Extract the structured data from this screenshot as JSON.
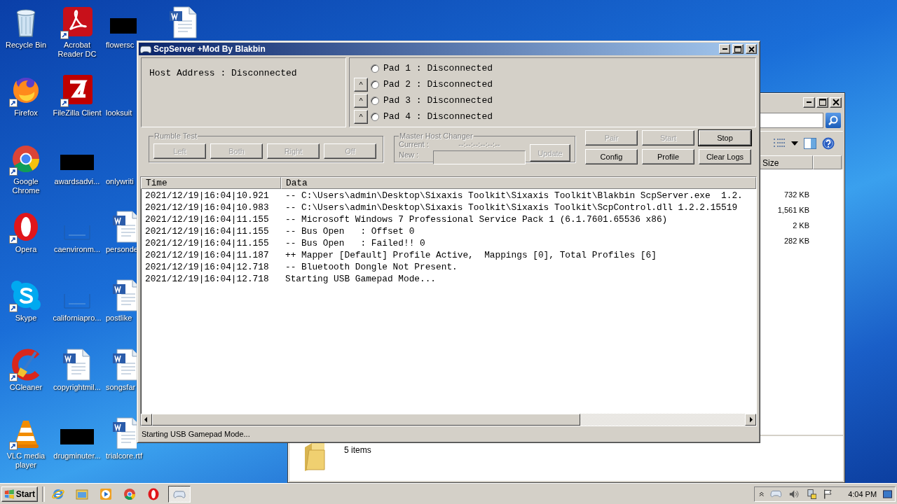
{
  "desktop": {
    "columns": [
      [
        {
          "label": "Recycle Bin",
          "kind": "recycle",
          "shortcut": false
        },
        {
          "label": "Firefox",
          "kind": "firefox",
          "shortcut": true
        },
        {
          "label": "Google Chrome",
          "kind": "chrome",
          "shortcut": true
        },
        {
          "label": "Opera",
          "kind": "opera",
          "shortcut": true
        },
        {
          "label": "Skype",
          "kind": "skype",
          "shortcut": true
        },
        {
          "label": "CCleaner",
          "kind": "ccleaner",
          "shortcut": true
        },
        {
          "label": "VLC media player",
          "kind": "vlc",
          "shortcut": true
        }
      ],
      [
        {
          "label": "Acrobat Reader DC",
          "kind": "acrobat",
          "shortcut": true
        },
        {
          "label": "FileZilla Client",
          "kind": "filezilla",
          "shortcut": true
        },
        {
          "label": "awardsadvi...",
          "kind": "redacted",
          "shortcut": false
        },
        {
          "label": "caenvironm...",
          "kind": "faint",
          "shortcut": false
        },
        {
          "label": "californiapro...",
          "kind": "faint",
          "shortcut": false
        },
        {
          "label": "copyrightmil...",
          "kind": "word",
          "shortcut": false
        },
        {
          "label": "drugminuter...",
          "kind": "redacted",
          "shortcut": false
        }
      ],
      [
        {
          "label": "flowersc",
          "kind": "redacted",
          "shortcut": false
        },
        {
          "label": "looksuit",
          "kind": "empty",
          "shortcut": false
        },
        {
          "label": "onlywriti",
          "kind": "empty",
          "shortcut": false
        },
        {
          "label": "personde",
          "kind": "word",
          "shortcut": false
        },
        {
          "label": "postlike",
          "kind": "word",
          "shortcut": false
        },
        {
          "label": "songsfar",
          "kind": "word",
          "shortcut": false
        },
        {
          "label": "trialcore.rtf",
          "kind": "word",
          "shortcut": false
        }
      ],
      [
        {
          "kind": "word",
          "shortcut": false
        }
      ]
    ]
  },
  "explorer_window": {
    "size_header": "Size",
    "sizes": [
      "732 KB",
      "1,561 KB",
      "2 KB",
      "282 KB"
    ],
    "details": "5 items"
  },
  "scp_window": {
    "title": "ScpServer +Mod By Blakbin",
    "host_address": "Host Address : Disconnected",
    "pads": [
      {
        "label": "Pad 1 : Disconnected",
        "selected": false
      },
      {
        "label": "Pad 2 : Disconnected",
        "selected": false,
        "button": "^"
      },
      {
        "label": "Pad 3 : Disconnected",
        "selected": false,
        "button": "^"
      },
      {
        "label": "Pad 4 : Disconnected",
        "selected": false,
        "button": "^"
      }
    ],
    "rumble": {
      "title": "Rumble Test",
      "buttons": [
        {
          "label": "Left",
          "disabled": true
        },
        {
          "label": "Both",
          "disabled": true
        },
        {
          "label": "Right",
          "disabled": true
        },
        {
          "label": "Off",
          "disabled": true
        }
      ]
    },
    "host_changer": {
      "title": "Master Host Changer",
      "current_label": "Current :",
      "current_value": "--:--:--:--:--:--",
      "new_label": "New :",
      "update": {
        "label": "Update",
        "disabled": true
      }
    },
    "actions": [
      {
        "label": "Pair",
        "disabled": true,
        "default": false
      },
      {
        "label": "Start",
        "disabled": true,
        "default": false
      },
      {
        "label": "Stop",
        "disabled": false,
        "default": true
      },
      {
        "label": "Config",
        "disabled": false,
        "default": false
      },
      {
        "label": "Profile",
        "disabled": false,
        "default": false
      },
      {
        "label": "Clear Logs",
        "disabled": false,
        "default": false
      }
    ],
    "log": {
      "columns": [
        "Time",
        "Data"
      ],
      "rows": [
        [
          "2021/12/19|16:04|10.921",
          "-- C:\\Users\\admin\\Desktop\\Sixaxis Toolkit\\Sixaxis Toolkit\\Blakbin ScpServer.exe  1.2."
        ],
        [
          "2021/12/19|16:04|10.983",
          "-- C:\\Users\\admin\\Desktop\\Sixaxis Toolkit\\Sixaxis Toolkit\\ScpControl.dll 1.2.2.15519"
        ],
        [
          "2021/12/19|16:04|11.155",
          "-- Microsoft Windows 7 Professional Service Pack 1 (6.1.7601.65536 x86)"
        ],
        [
          "2021/12/19|16:04|11.155",
          "-- Bus Open   : Offset 0"
        ],
        [
          "2021/12/19|16:04|11.155",
          "-- Bus Open   : Failed!! 0"
        ],
        [
          "2021/12/19|16:04|11.187",
          "++ Mapper [Default] Profile Active,  Mappings [0], Total Profiles [6]"
        ],
        [
          "2021/12/19|16:04|12.718",
          "-- Bluetooth Dongle Not Present."
        ],
        [
          "2021/12/19|16:04|12.718",
          "Starting USB Gamepad Mode..."
        ]
      ]
    },
    "status": "Starting USB Gamepad Mode..."
  },
  "taskbar": {
    "start": "Start",
    "items": [
      {
        "kind": "ie",
        "selected": false
      },
      {
        "kind": "folder",
        "selected": false
      },
      {
        "kind": "media",
        "selected": false
      },
      {
        "kind": "chrome",
        "selected": false
      },
      {
        "kind": "opera",
        "selected": false
      },
      {
        "kind": "gamepad",
        "selected": true
      }
    ],
    "clock": "4:04 PM"
  }
}
